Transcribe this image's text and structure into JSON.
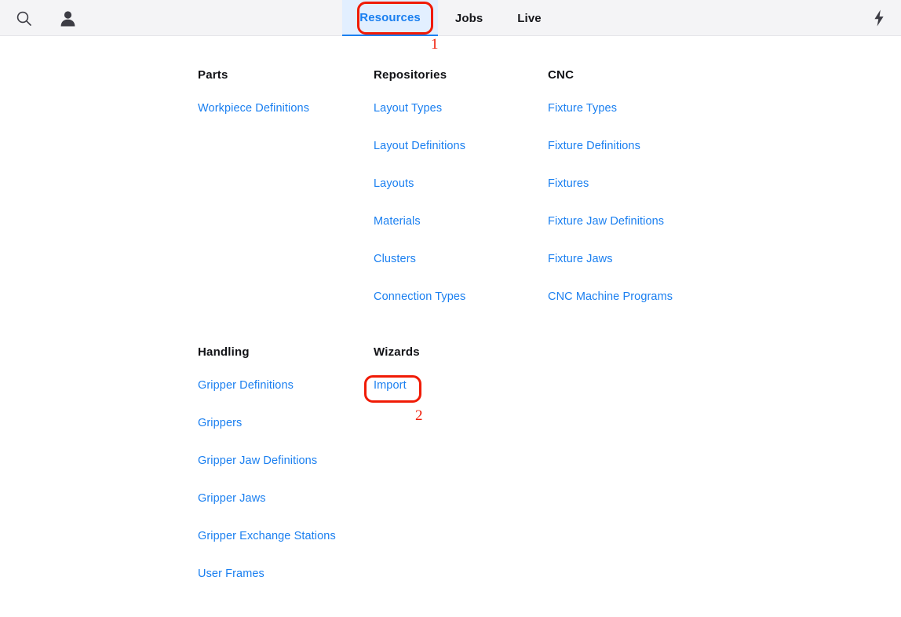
{
  "header": {
    "icons": [
      {
        "name": "search-icon",
        "label": "Search"
      },
      {
        "name": "user-icon",
        "label": "User"
      },
      {
        "name": "power-bolt-icon",
        "label": "Live Power"
      }
    ],
    "tabs": [
      {
        "label": "Resources",
        "active": true
      },
      {
        "label": "Jobs",
        "active": false
      },
      {
        "label": "Live",
        "active": false
      }
    ],
    "active_tab": "Resources",
    "background_color": "#f4f4f6",
    "active_tab_background": "#e2efff",
    "active_tab_color": "#1a7ff0"
  },
  "menu": {
    "link_color": "#1a7ff0",
    "heading_color": "#111216",
    "rows": [
      {
        "columns": [
          {
            "heading": "Parts",
            "links": [
              "Workpiece Definitions"
            ]
          },
          {
            "heading": "Repositories",
            "links": [
              "Layout Types",
              "Layout Definitions",
              "Layouts",
              "Materials",
              "Clusters",
              "Connection Types"
            ]
          },
          {
            "heading": "CNC",
            "links": [
              "Fixture Types",
              "Fixture Definitions",
              "Fixtures",
              "Fixture Jaw Definitions",
              "Fixture Jaws",
              "CNC Machine Programs"
            ]
          }
        ]
      },
      {
        "columns": [
          {
            "heading": "Handling",
            "links": [
              "Gripper Definitions",
              "Grippers",
              "Gripper Jaw Definitions",
              "Gripper Jaws",
              "Gripper Exchange Stations",
              "User Frames"
            ]
          },
          {
            "heading": "Wizards",
            "links": [
              "Import"
            ]
          },
          {
            "heading": "",
            "links": []
          }
        ]
      }
    ]
  },
  "annotations": {
    "color": "#f01b06",
    "markers": [
      {
        "number": "1",
        "target": "Resources"
      },
      {
        "number": "2",
        "target": "Import"
      }
    ]
  }
}
